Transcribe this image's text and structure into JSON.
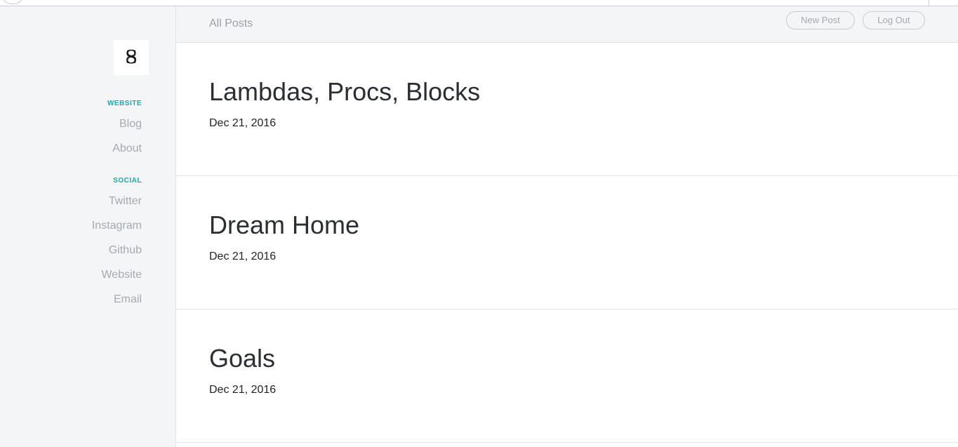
{
  "sidebar": {
    "logo_icon": "monogram-logo-icon",
    "sections": [
      {
        "heading": "WEBSITE",
        "items": [
          "Blog",
          "About"
        ]
      },
      {
        "heading": "SOCIAL",
        "items": [
          "Twitter",
          "Instagram",
          "Github",
          "Website",
          "Email"
        ]
      }
    ]
  },
  "topbar": {
    "title": "All Posts",
    "new_post_label": "New Post",
    "log_out_label": "Log Out"
  },
  "posts": [
    {
      "title": "Lambdas, Procs, Blocks",
      "date": "Dec 21, 2016"
    },
    {
      "title": "Dream Home",
      "date": "Dec 21, 2016"
    },
    {
      "title": "Goals",
      "date": "Dec 21, 2016"
    }
  ],
  "colors": {
    "accent": "#25a4a9",
    "sidebar_bg": "#f4f5f6",
    "muted_text": "#a4aab0",
    "title_text": "#2b2f33"
  }
}
